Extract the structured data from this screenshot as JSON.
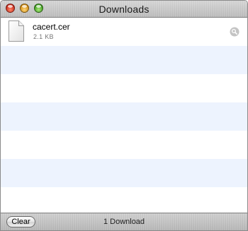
{
  "window": {
    "title": "Downloads"
  },
  "downloads": [
    {
      "name": "cacert.cer",
      "size": "2.1 KB",
      "icon": "document-icon",
      "action_icon": "magnifier-icon"
    }
  ],
  "footer": {
    "clear_label": "Clear",
    "status": "1 Download"
  },
  "colors": {
    "row_alt": "#edf3fe",
    "close": "#e0443a",
    "minimize": "#f0b030",
    "zoom": "#5cc040"
  }
}
